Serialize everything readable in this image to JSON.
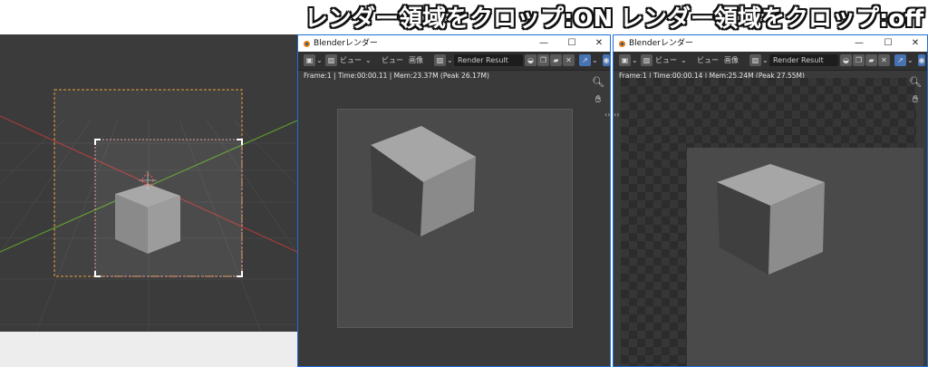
{
  "captions": {
    "crop_on": "レンダー領域をクロップ:ON",
    "crop_off": "レンダー領域をクロップ:off"
  },
  "viewport": {
    "description_icon": "camera-border"
  },
  "window_on": {
    "title": "Blenderレンダー",
    "minimize": "—",
    "maximize": "☐",
    "close": "✕",
    "toolbar": {
      "editor_type": "▣",
      "view_menu": "ビュー",
      "view_menu2": "ビュー",
      "image_menu": "画像",
      "image_name": "Render Result"
    },
    "info": "Frame:1 | Time:00:00.11 | Mem:23.37M (Peak 26.17M)",
    "zoom_icon": "zoom-icon",
    "hand_icon": "hand-icon"
  },
  "window_off": {
    "title": "Blenderレンダー",
    "minimize": "—",
    "maximize": "☐",
    "close": "✕",
    "toolbar": {
      "editor_type": "▣",
      "view_menu": "ビュー",
      "view_menu2": "ビュー",
      "image_menu": "画像",
      "image_name": "Render Result"
    },
    "info": "Frame:1 | Time:00:00.14 | Mem:25.24M (Peak 27.55M)",
    "zoom_icon": "zoom-icon",
    "hand_icon": "hand-icon"
  },
  "colors": {
    "accent_blue": "#1f6fd6",
    "camera_border": "#e8a23a",
    "x_axis": "#b23b3b",
    "y_axis": "#5a9a2c"
  }
}
